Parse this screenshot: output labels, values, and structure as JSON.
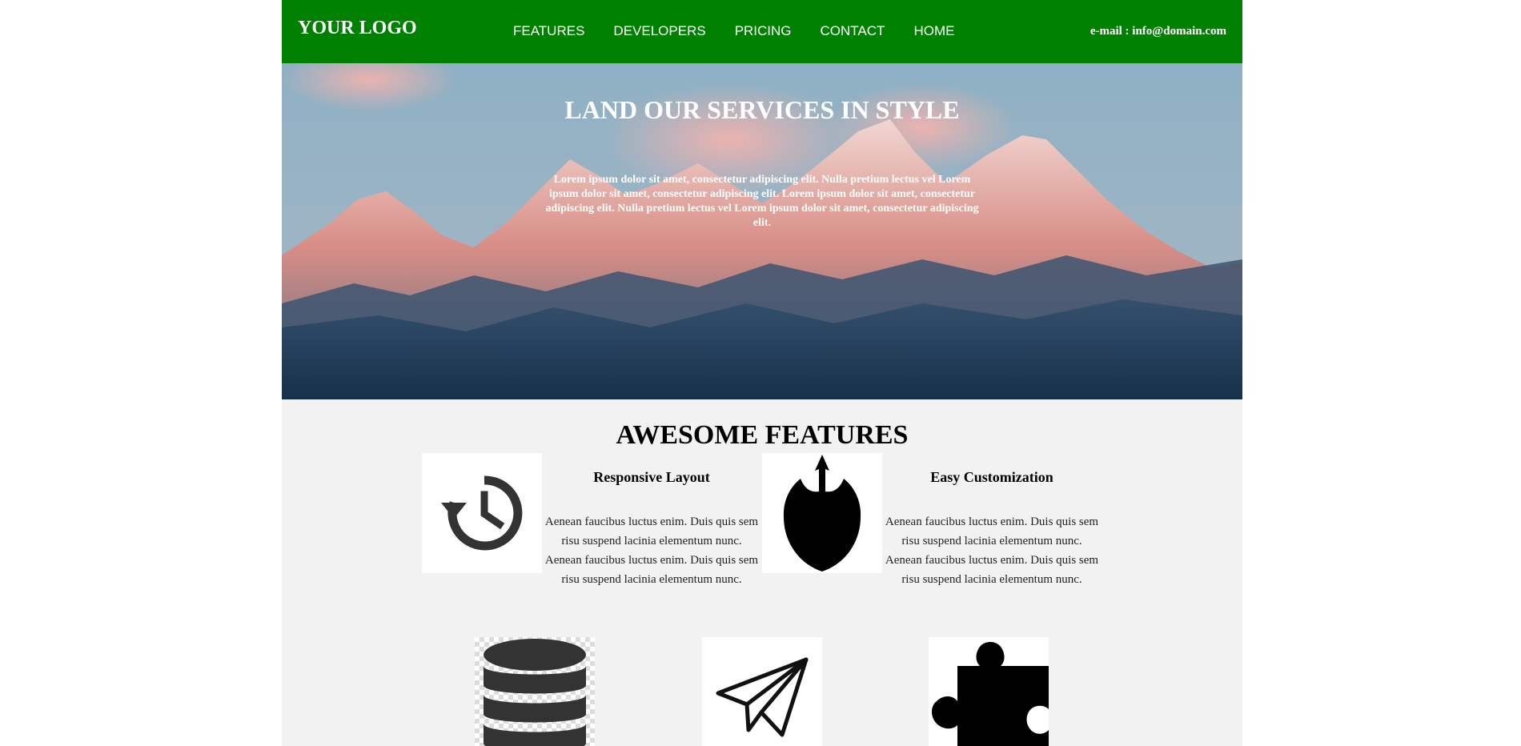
{
  "header": {
    "logo": "YOUR LOGO",
    "nav": [
      "FEATURES",
      "DEVELOPERS",
      "PRICING",
      "CONTACT",
      "HOME"
    ],
    "email": "e-mail : info@domain.com",
    "background_color": "#008000"
  },
  "hero": {
    "title": "LAND OUR SERVICES IN STYLE",
    "text": "Lorem ipsum dolor sit amet, consectetur adipiscing elit. Nulla pretium lectus vel Lorem ipsum dolor sit amet, consectetur adipiscing elit. Lorem ipsum dolor sit amet, consectetur adipiscing elit. Nulla pretium lectus vel Lorem ipsum dolor sit amet, consectetur adipiscing elit.",
    "background": "mountain-landscape-image"
  },
  "features": {
    "title": "AWESOME FEATURES",
    "items": [
      {
        "icon": "history-icon",
        "heading": "Responsive Layout",
        "text": "Aenean faucibus luctus enim. Duis quis sem risu suspend lacinia elementum nunc. Aenean faucibus luctus enim. Duis quis sem risu suspend lacinia elementum nunc."
      },
      {
        "icon": "rebel-alliance-icon",
        "heading": "Easy Customization",
        "text": "Aenean faucibus luctus enim. Duis quis sem risu suspend lacinia elementum nunc. Aenean faucibus luctus enim. Duis quis sem risu suspend lacinia elementum nunc."
      }
    ],
    "bottom_icons": [
      "database-icon",
      "paper-plane-icon",
      "puzzle-icon"
    ]
  }
}
